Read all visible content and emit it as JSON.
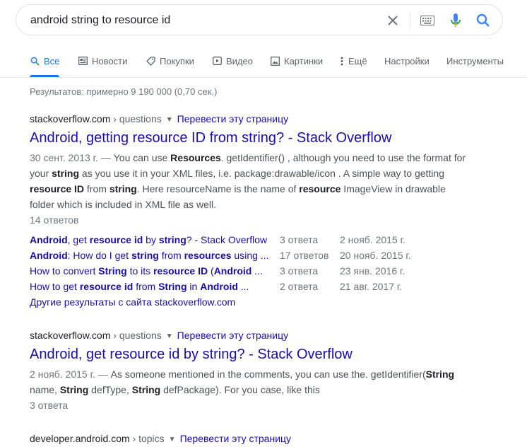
{
  "search": {
    "query": "android string to resource id"
  },
  "tabs": [
    {
      "label": "Все",
      "icon": "search-icon"
    },
    {
      "label": "Новости",
      "icon": "news-icon"
    },
    {
      "label": "Покупки",
      "icon": "tag-icon"
    },
    {
      "label": "Видео",
      "icon": "play-icon"
    },
    {
      "label": "Картинки",
      "icon": "image-icon"
    },
    {
      "label": "Ещё",
      "icon": "more-vert-icon"
    },
    {
      "label": "Настройки"
    },
    {
      "label": "Инструменты"
    }
  ],
  "stats": "Результатов: примерно 9 190 000 (0,70 сек.)",
  "results": [
    {
      "domain": "stackoverflow.com",
      "crumb": "› questions",
      "translate": "Перевести эту страницу",
      "title": "Android, getting resource ID from string? - Stack Overflow",
      "date": "30 сент. 2013 г. —",
      "snippet": [
        {
          "t": " You can use "
        },
        {
          "b": "Resources"
        },
        {
          "t": ". getIdentifier() , although you need to use the format for your "
        },
        {
          "b": "string"
        },
        {
          "t": " as you use it in your XML files, i.e. package:drawable/icon . A simple way to getting "
        },
        {
          "b": "resource ID"
        },
        {
          "t": " from "
        },
        {
          "b": "string"
        },
        {
          "t": ". Here resourceName is the name of "
        },
        {
          "b": "resource"
        },
        {
          "t": " ImageView in drawable folder which is included in XML file as well."
        }
      ],
      "count": "14 ответов",
      "sitelinks": [
        {
          "parts": [
            {
              "b": "Android"
            },
            {
              "t": ", get "
            },
            {
              "b": "resource id"
            },
            {
              "t": " by "
            },
            {
              "b": "string"
            },
            {
              "t": "? - Stack Overflow"
            }
          ],
          "answers": "3 ответа",
          "date": "2 нояб. 2015 г."
        },
        {
          "parts": [
            {
              "b": "Android"
            },
            {
              "t": ": How do I get "
            },
            {
              "b": "string"
            },
            {
              "t": " from "
            },
            {
              "b": "resources"
            },
            {
              "t": " using ..."
            }
          ],
          "answers": "17 ответов",
          "date": "20 нояб. 2015 г."
        },
        {
          "parts": [
            {
              "t": "How to convert "
            },
            {
              "b": "String"
            },
            {
              "t": " to its "
            },
            {
              "b": "resource ID"
            },
            {
              "t": " ("
            },
            {
              "b": "Android"
            },
            {
              "t": " ..."
            }
          ],
          "answers": "3 ответа",
          "date": "23 янв. 2016 г."
        },
        {
          "parts": [
            {
              "t": "How to get "
            },
            {
              "b": "resource id"
            },
            {
              "t": " from "
            },
            {
              "b": "String"
            },
            {
              "t": " in "
            },
            {
              "b": "Android"
            },
            {
              "t": " ..."
            }
          ],
          "answers": "2 ответа",
          "date": "21 авг. 2017 г."
        }
      ],
      "more": "Другие результаты с сайта stackoverflow.com"
    },
    {
      "domain": "stackoverflow.com",
      "crumb": "› questions",
      "translate": "Перевести эту страницу",
      "title": "Android, get resource id by string? - Stack Overflow",
      "date": "2 нояб. 2015 г. —",
      "snippet": [
        {
          "t": " As someone mentioned in the comments, you can use the. getIdentifier("
        },
        {
          "b": "String"
        },
        {
          "t": " name, "
        },
        {
          "b": "String"
        },
        {
          "t": " defType, "
        },
        {
          "b": "String"
        },
        {
          "t": " defPackage). For you case, like this"
        }
      ],
      "count": "3 ответа"
    },
    {
      "domain": "developer.android.com",
      "crumb": "› topics",
      "translate": "Перевести эту страницу"
    }
  ],
  "colors": {
    "link": "#1a0dab",
    "accent": "#1a73e8",
    "text": "#202124",
    "muted": "#70757a"
  }
}
